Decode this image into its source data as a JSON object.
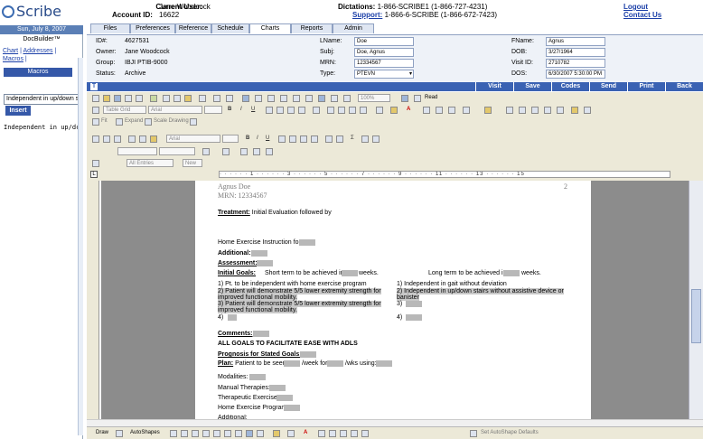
{
  "app": {
    "logo": "Scribe"
  },
  "header": {
    "current_user_label": "Current User:",
    "current_user": "Jane Woodcock",
    "account_id_label": "Account ID:",
    "account_id": "16622",
    "dictations_label": "Dictations:",
    "dictations": "1-866-SCRIBE1 (1-866-727-4231)",
    "support_label": "Support:",
    "support": "1-866-6-SCRIBE (1-866-672-7423)",
    "logout": "Logout",
    "contact_us": "Contact Us"
  },
  "left_panel": {
    "date": "Sun, July 8, 2007",
    "docbuilder": "DocBuilder™",
    "links": [
      "Chart",
      "Addresses",
      "Macros"
    ],
    "macros_title": "Macros",
    "macro_input": "Independent in up/down s",
    "insert_label": "Insert",
    "macro_text": "Independent in up/dc"
  },
  "tabs": [
    "Files",
    "Preferences",
    "Reference",
    "Schedule",
    "Charts",
    "Reports",
    "Admin"
  ],
  "active_tab": "Charts",
  "info": {
    "id_label": "ID#:",
    "id": "4627531",
    "owner_label": "Owner:",
    "owner": "Jane Woodcock",
    "group_label": "Group:",
    "group": "IBJI PTIB-9000",
    "status_label": "Status:",
    "status": "Archive",
    "lname_label": "LName:",
    "lname": "Doe",
    "subj_label": "Subj:",
    "subj": "Doe, Agnus",
    "mrn_label": "MRN:",
    "mrn": "12334567",
    "type_label": "Type:",
    "type": "PTEVN",
    "fname_label": "FName:",
    "fname": "Agnus",
    "dob_label": "DOB:",
    "dob": "3/27/1964",
    "visit_id_label": "Visit ID:",
    "visit_id": "2710782",
    "dos_label": "DOS:",
    "dos": "6/30/2007 5:30:00 PM"
  },
  "actions": [
    "Visit",
    "Save",
    "Codes",
    "Send",
    "Print",
    "Back"
  ],
  "toolbar": {
    "zoom": "100%",
    "read": "Read",
    "table_grid": "Table Grid",
    "font1": "Arial",
    "font2": "Arial",
    "fit": "Fit",
    "expand": "Expand",
    "scale_drawing": "Scale Drawing",
    "all_entries": "All Entries",
    "new": "New",
    "draw": "Draw",
    "autoshapes": "AutoShapes",
    "set_autoshape_defaults": "Set AutoShape Defaults"
  },
  "document": {
    "patient_name": "Agnus Doe",
    "mrn_line": "MRN: 12334567",
    "page_number": "2",
    "treatment_label": "Treatment:",
    "treatment_text": "Initial Evaluation followed by",
    "hep_label": "Home Exercise Instruction for:",
    "additional_label": "Additional:",
    "assessment_label": "Assessment:",
    "initial_goals_label": "Initial Goals:",
    "short_term": "Short term to be achieved in",
    "weeks1": "weeks.",
    "long_term": "Long term to be achieved in",
    "weeks2": "weeks.",
    "st_goals": [
      "1)  Pt. to be independent with home exercise program",
      "2)  Patient will demonstrate 5/5 lower extremity strength for",
      "improved functional mobility.",
      "3)  Patient will demonstrate 5/5 lower extremity strength for",
      "improved functional mobility.",
      "4)"
    ],
    "lt_goals": [
      "1)  Independent in gait without deviation",
      "2)  Independent in up/down stairs without assistive device or",
      "banister",
      "3)",
      "4)"
    ],
    "comments_label": "Comments:",
    "all_goals": "ALL GOALS TO FACILITATE EASE WITH ADLS",
    "prognosis_label": "Prognosis for Stated Goals:",
    "plan_label": "Plan:",
    "plan_text1": "Patient to be seen",
    "plan_text2": "/week for",
    "plan_text3": "/wks using:",
    "modalities": "Modalities:",
    "manual": "Manual Therapies:",
    "therapeutic": "Therapeutic Exercise",
    "hep2": "Home Exercise Program",
    "additional2": "Additional:"
  }
}
